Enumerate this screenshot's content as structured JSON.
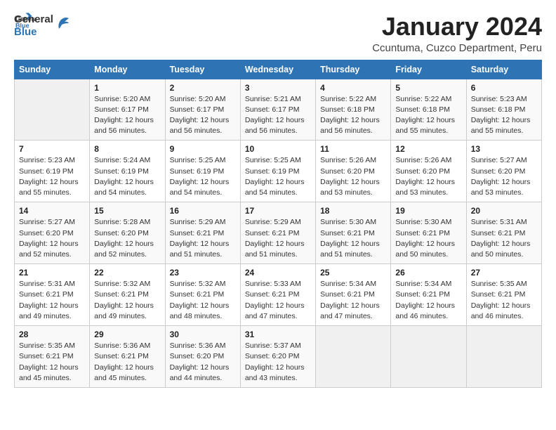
{
  "header": {
    "logo_line1": "General",
    "logo_line2": "Blue",
    "month": "January 2024",
    "location": "Ccuntuma, Cuzco Department, Peru"
  },
  "weekdays": [
    "Sunday",
    "Monday",
    "Tuesday",
    "Wednesday",
    "Thursday",
    "Friday",
    "Saturday"
  ],
  "weeks": [
    [
      {
        "day": "",
        "sunrise": "",
        "sunset": "",
        "daylight": ""
      },
      {
        "day": "1",
        "sunrise": "Sunrise: 5:20 AM",
        "sunset": "Sunset: 6:17 PM",
        "daylight": "Daylight: 12 hours and 56 minutes."
      },
      {
        "day": "2",
        "sunrise": "Sunrise: 5:20 AM",
        "sunset": "Sunset: 6:17 PM",
        "daylight": "Daylight: 12 hours and 56 minutes."
      },
      {
        "day": "3",
        "sunrise": "Sunrise: 5:21 AM",
        "sunset": "Sunset: 6:17 PM",
        "daylight": "Daylight: 12 hours and 56 minutes."
      },
      {
        "day": "4",
        "sunrise": "Sunrise: 5:22 AM",
        "sunset": "Sunset: 6:18 PM",
        "daylight": "Daylight: 12 hours and 56 minutes."
      },
      {
        "day": "5",
        "sunrise": "Sunrise: 5:22 AM",
        "sunset": "Sunset: 6:18 PM",
        "daylight": "Daylight: 12 hours and 55 minutes."
      },
      {
        "day": "6",
        "sunrise": "Sunrise: 5:23 AM",
        "sunset": "Sunset: 6:18 PM",
        "daylight": "Daylight: 12 hours and 55 minutes."
      }
    ],
    [
      {
        "day": "7",
        "sunrise": "Sunrise: 5:23 AM",
        "sunset": "Sunset: 6:19 PM",
        "daylight": "Daylight: 12 hours and 55 minutes."
      },
      {
        "day": "8",
        "sunrise": "Sunrise: 5:24 AM",
        "sunset": "Sunset: 6:19 PM",
        "daylight": "Daylight: 12 hours and 54 minutes."
      },
      {
        "day": "9",
        "sunrise": "Sunrise: 5:25 AM",
        "sunset": "Sunset: 6:19 PM",
        "daylight": "Daylight: 12 hours and 54 minutes."
      },
      {
        "day": "10",
        "sunrise": "Sunrise: 5:25 AM",
        "sunset": "Sunset: 6:19 PM",
        "daylight": "Daylight: 12 hours and 54 minutes."
      },
      {
        "day": "11",
        "sunrise": "Sunrise: 5:26 AM",
        "sunset": "Sunset: 6:20 PM",
        "daylight": "Daylight: 12 hours and 53 minutes."
      },
      {
        "day": "12",
        "sunrise": "Sunrise: 5:26 AM",
        "sunset": "Sunset: 6:20 PM",
        "daylight": "Daylight: 12 hours and 53 minutes."
      },
      {
        "day": "13",
        "sunrise": "Sunrise: 5:27 AM",
        "sunset": "Sunset: 6:20 PM",
        "daylight": "Daylight: 12 hours and 53 minutes."
      }
    ],
    [
      {
        "day": "14",
        "sunrise": "Sunrise: 5:27 AM",
        "sunset": "Sunset: 6:20 PM",
        "daylight": "Daylight: 12 hours and 52 minutes."
      },
      {
        "day": "15",
        "sunrise": "Sunrise: 5:28 AM",
        "sunset": "Sunset: 6:20 PM",
        "daylight": "Daylight: 12 hours and 52 minutes."
      },
      {
        "day": "16",
        "sunrise": "Sunrise: 5:29 AM",
        "sunset": "Sunset: 6:21 PM",
        "daylight": "Daylight: 12 hours and 51 minutes."
      },
      {
        "day": "17",
        "sunrise": "Sunrise: 5:29 AM",
        "sunset": "Sunset: 6:21 PM",
        "daylight": "Daylight: 12 hours and 51 minutes."
      },
      {
        "day": "18",
        "sunrise": "Sunrise: 5:30 AM",
        "sunset": "Sunset: 6:21 PM",
        "daylight": "Daylight: 12 hours and 51 minutes."
      },
      {
        "day": "19",
        "sunrise": "Sunrise: 5:30 AM",
        "sunset": "Sunset: 6:21 PM",
        "daylight": "Daylight: 12 hours and 50 minutes."
      },
      {
        "day": "20",
        "sunrise": "Sunrise: 5:31 AM",
        "sunset": "Sunset: 6:21 PM",
        "daylight": "Daylight: 12 hours and 50 minutes."
      }
    ],
    [
      {
        "day": "21",
        "sunrise": "Sunrise: 5:31 AM",
        "sunset": "Sunset: 6:21 PM",
        "daylight": "Daylight: 12 hours and 49 minutes."
      },
      {
        "day": "22",
        "sunrise": "Sunrise: 5:32 AM",
        "sunset": "Sunset: 6:21 PM",
        "daylight": "Daylight: 12 hours and 49 minutes."
      },
      {
        "day": "23",
        "sunrise": "Sunrise: 5:32 AM",
        "sunset": "Sunset: 6:21 PM",
        "daylight": "Daylight: 12 hours and 48 minutes."
      },
      {
        "day": "24",
        "sunrise": "Sunrise: 5:33 AM",
        "sunset": "Sunset: 6:21 PM",
        "daylight": "Daylight: 12 hours and 47 minutes."
      },
      {
        "day": "25",
        "sunrise": "Sunrise: 5:34 AM",
        "sunset": "Sunset: 6:21 PM",
        "daylight": "Daylight: 12 hours and 47 minutes."
      },
      {
        "day": "26",
        "sunrise": "Sunrise: 5:34 AM",
        "sunset": "Sunset: 6:21 PM",
        "daylight": "Daylight: 12 hours and 46 minutes."
      },
      {
        "day": "27",
        "sunrise": "Sunrise: 5:35 AM",
        "sunset": "Sunset: 6:21 PM",
        "daylight": "Daylight: 12 hours and 46 minutes."
      }
    ],
    [
      {
        "day": "28",
        "sunrise": "Sunrise: 5:35 AM",
        "sunset": "Sunset: 6:21 PM",
        "daylight": "Daylight: 12 hours and 45 minutes."
      },
      {
        "day": "29",
        "sunrise": "Sunrise: 5:36 AM",
        "sunset": "Sunset: 6:21 PM",
        "daylight": "Daylight: 12 hours and 45 minutes."
      },
      {
        "day": "30",
        "sunrise": "Sunrise: 5:36 AM",
        "sunset": "Sunset: 6:20 PM",
        "daylight": "Daylight: 12 hours and 44 minutes."
      },
      {
        "day": "31",
        "sunrise": "Sunrise: 5:37 AM",
        "sunset": "Sunset: 6:20 PM",
        "daylight": "Daylight: 12 hours and 43 minutes."
      },
      {
        "day": "",
        "sunrise": "",
        "sunset": "",
        "daylight": ""
      },
      {
        "day": "",
        "sunrise": "",
        "sunset": "",
        "daylight": ""
      },
      {
        "day": "",
        "sunrise": "",
        "sunset": "",
        "daylight": ""
      }
    ]
  ]
}
